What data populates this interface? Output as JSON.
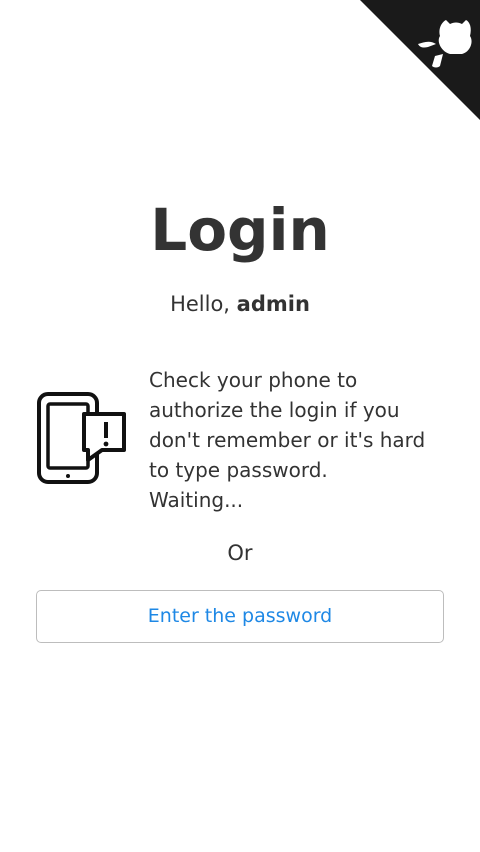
{
  "corner": {
    "icon": "github-octocat-icon",
    "background": "#1a1a1a",
    "icon_color": "#ffffff"
  },
  "login": {
    "title": "Login",
    "greeting_prefix": "Hello, ",
    "username": "admin",
    "phone_icon": "phone-alert-icon",
    "message_lines": [
      "Check your phone to",
      "authorize the login if you",
      "don't remember or it's hard",
      "to type password.",
      "Waiting..."
    ],
    "or_text": "Or",
    "password_button_label": "Enter the password"
  },
  "colors": {
    "accent": "#1e88e5",
    "text": "#333333",
    "border": "#bdbdbd"
  }
}
